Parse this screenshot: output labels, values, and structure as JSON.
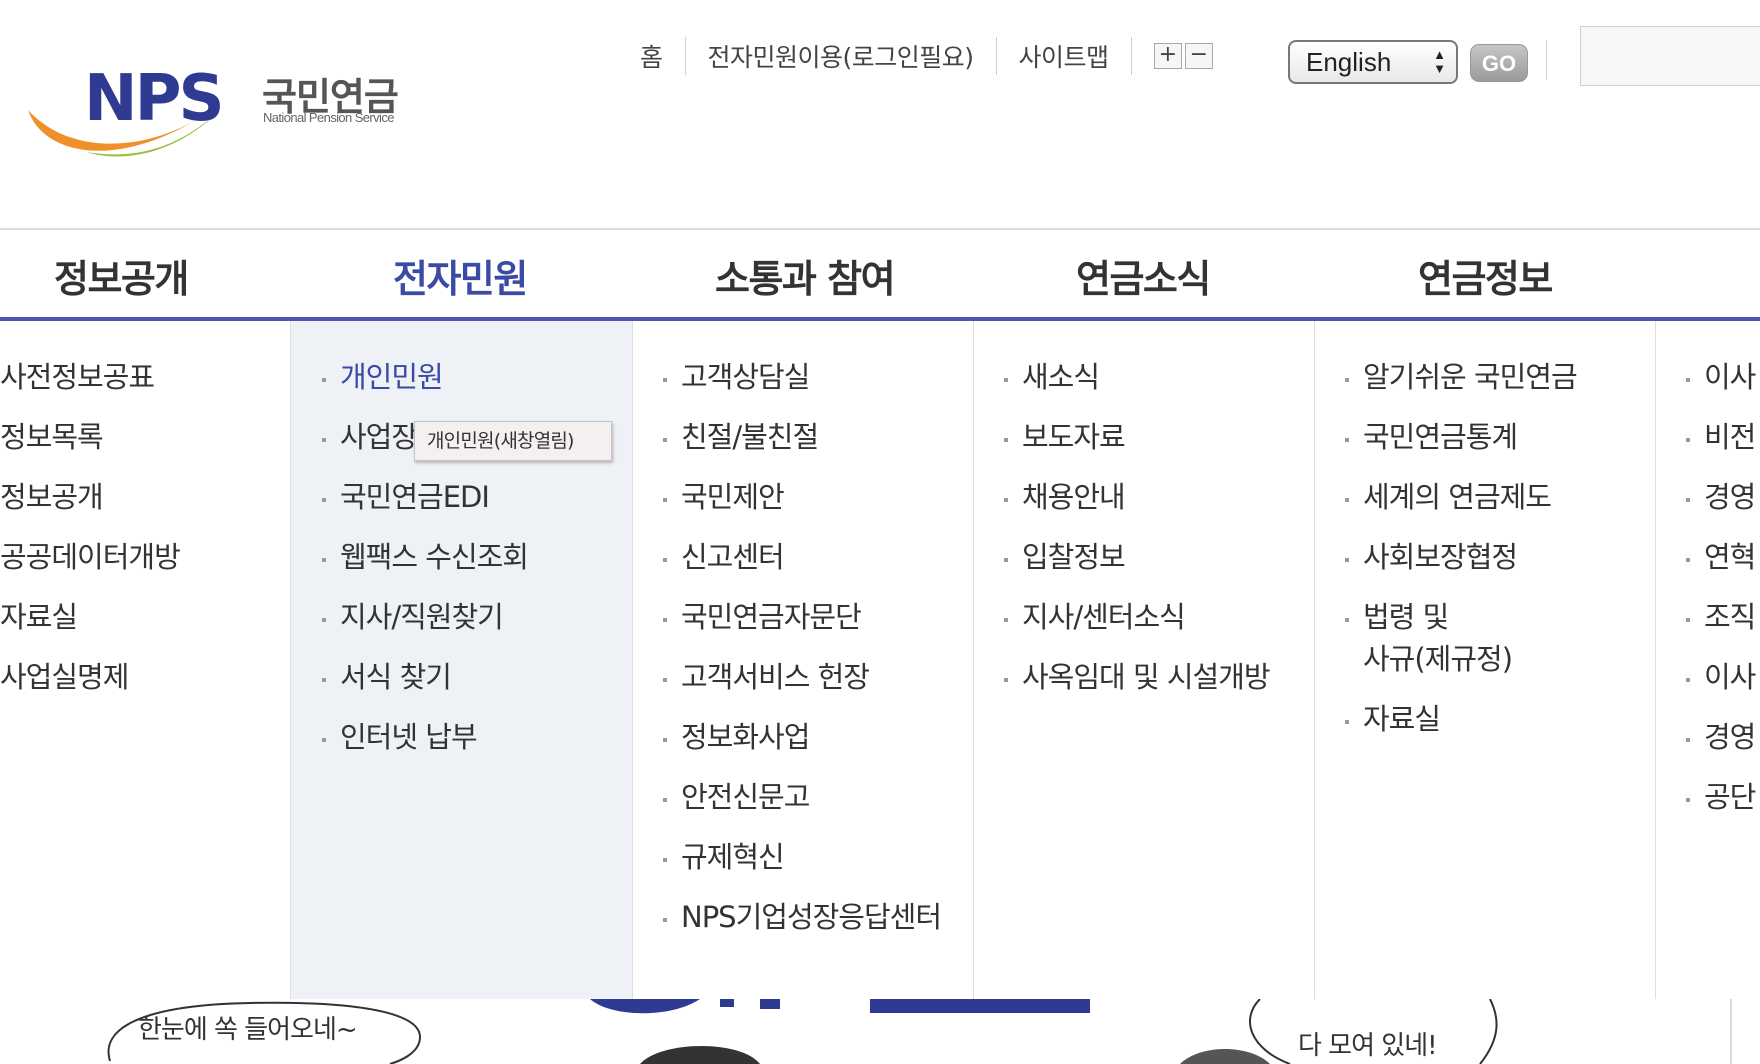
{
  "header": {
    "logo": {
      "mark": "NPS",
      "name_ko": "국민연금",
      "name_en": "National Pension Service"
    },
    "util_links": [
      "홈",
      "전자민원이용(로그인필요)",
      "사이트맵"
    ],
    "zoom": {
      "plus": "+",
      "minus": "−"
    },
    "language": {
      "selected": "English",
      "arrows": "▲\n▼"
    },
    "go_label": "GO"
  },
  "gnb": {
    "items": [
      "정보공개",
      "전자민원",
      "소통과 참여",
      "연금소식",
      "연금정보"
    ],
    "active_index": 1
  },
  "mega_menu": {
    "columns": [
      {
        "items": [
          "사전정보공표",
          "정보목록",
          "정보공개",
          "공공데이터개방",
          "자료실",
          "사업실명제"
        ]
      },
      {
        "items": [
          "개인민원",
          "사업장",
          "국민연금EDI",
          "웹팩스 수신조회",
          "지사/직원찾기",
          "서식 찾기",
          "인터넷 납부"
        ]
      },
      {
        "items": [
          "고객상담실",
          "친절/불친절",
          "국민제안",
          "신고센터",
          "국민연금자문단",
          "고객서비스 헌장",
          "정보화사업",
          "안전신문고",
          "규제혁신",
          "NPS기업성장응답센터"
        ]
      },
      {
        "items": [
          "새소식",
          "보도자료",
          "채용안내",
          "입찰정보",
          "지사/센터소식",
          "사옥임대 및 시설개방"
        ]
      },
      {
        "items": [
          "알기쉬운 국민연금",
          "국민연금통계",
          "세계의 연금제도",
          "사회보장협정",
          "법령 및",
          "사규(제규정)",
          "자료실"
        ]
      },
      {
        "items": [
          "이사",
          "비전",
          "경영",
          "연혁",
          "조직",
          "이사",
          "경영",
          "공단"
        ]
      }
    ],
    "tooltip": "개인민원(새창열림)"
  },
  "banner": {
    "bubble_left": "한눈에 쏙 들어오네~",
    "bubble_right_line1": "...",
    "bubble_right_line2": "다 모여 있네!"
  },
  "colors": {
    "brand_blue": "#3b4ba3",
    "menu_active_bg": "#eef1f6",
    "gnb_line": "#4a57ad"
  }
}
